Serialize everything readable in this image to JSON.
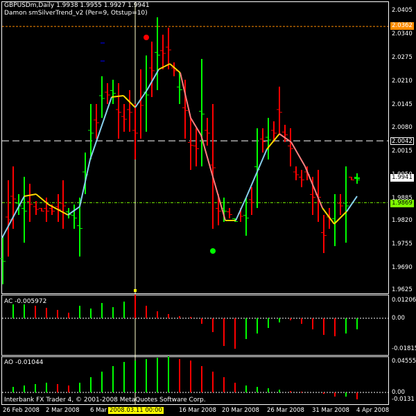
{
  "main": {
    "title": "GBPUSDm,Daily  1.9938 1.9955 1.9927 1.9941",
    "indicator_label": "Damon smSilverTrend_v2  (Per=9,  Otstup=10)",
    "price_axis": [
      "2.0405",
      "2.0340",
      "2.0275",
      "2.0210",
      "2.0145",
      "2.0080",
      "2.0015",
      "1.9950",
      "1.9885",
      "1.9820",
      "1.9755",
      "1.9690",
      "1.9625"
    ],
    "tag_orange": "2.0362",
    "tag_white": "2.0042",
    "tag_bid": "1.9941",
    "tag_green": "1.9869"
  },
  "ac": {
    "label": "AC -0.005972",
    "axis": [
      "0.012066",
      "0.00",
      "-0.01815"
    ]
  },
  "ao": {
    "label": "AO -0.01044",
    "axis": [
      "0.04555",
      "0.00",
      "-0.0131"
    ]
  },
  "footer": {
    "copyright": "Interbank FX Trader 4, © 2001-2008 MetaQuotes Software Corp."
  },
  "time_axis": {
    "labels": [
      "26 Feb 2008",
      "2 Mar 2008",
      "6 Mar",
      "16 Mar 2008",
      "20 Mar 2008",
      "26 Mar 2008",
      "31 Mar 2008",
      "4 Apr 2008"
    ],
    "crosshair_label": "2008.03.11 00:00"
  },
  "colors": {
    "up": "#00ff00",
    "down": "#ff0000",
    "trend_up": "#87ceeb",
    "trend_down": "#ff7f7f",
    "trend_flat": "#ffd700",
    "orange_line": "#ff8c00",
    "green_line": "#7fff00"
  },
  "chart_data": {
    "type": "bar",
    "symbol": "GBPUSDm",
    "timeframe": "Daily",
    "ylim": [
      1.9625,
      2.0405
    ],
    "price_levels": {
      "resistance": 2.0362,
      "dashed": 2.0042,
      "green": 1.9869,
      "bid": 1.9941
    },
    "ohlc_sample_last": {
      "open": 1.9938,
      "high": 1.9955,
      "low": 1.9927,
      "close": 1.9941
    },
    "ac_last": -0.005972,
    "ao_last": -0.01044
  }
}
